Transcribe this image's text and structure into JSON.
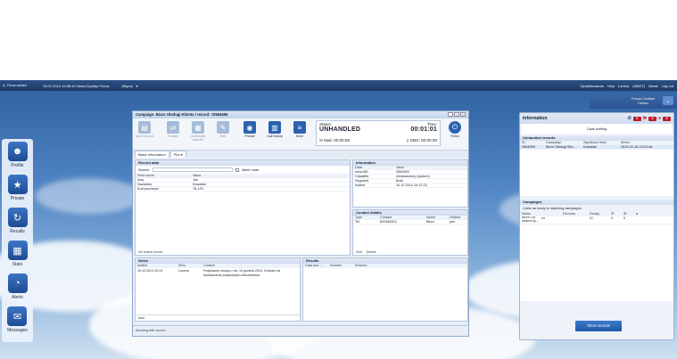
{
  "topbar": {
    "logo": "Focus contact",
    "datetime": "15.01.2014 15:08:10 News-Synteja Focus",
    "menu": "Więcej",
    "right_items": [
      "Opublikowania",
      "Help",
      "Lorena",
      "(30007)",
      "Break",
      "Log out"
    ]
  },
  "top_right": {
    "title": "Focus Contact Center"
  },
  "nav": [
    {
      "label": "Profile",
      "icon": "person-icon"
    },
    {
      "label": "Private",
      "icon": "star-icon"
    },
    {
      "label": "Recalls",
      "icon": "recall-icon"
    },
    {
      "label": "Stats",
      "icon": "chart-icon"
    },
    {
      "label": "Alerts",
      "icon": "pie-icon"
    },
    {
      "label": "Messages",
      "icon": "message-icon"
    }
  ],
  "window": {
    "title": "Campaign: Biuro Obsługi Klienta / record: #2584599",
    "toolbar": [
      {
        "label": "Move record",
        "enabled": false
      },
      {
        "label": "Transfer",
        "enabled": false
      },
      {
        "label": "Scheduled transfer",
        "enabled": false
      },
      {
        "label": "Hint",
        "enabled": false
      },
      {
        "label": "Private",
        "enabled": true
      },
      {
        "label": "Call history",
        "enabled": true
      },
      {
        "label": "More",
        "enabled": true
      }
    ],
    "status_label": "Status:",
    "status_value": "UNHANDLED",
    "time_label": "Time:",
    "time_value": "00:01:01",
    "mail_label": "Mail: 00:00:00",
    "sms_label": "SMS: 00:00:00",
    "finish_label": "Finish",
    "tabs": [
      "Basic information",
      "Plot"
    ],
    "record_data": {
      "title": "Record data",
      "search_label": "Search:",
      "match_case": "Match case",
      "headers": [
        "Field name",
        "Value"
      ],
      "rows": [
        [
          "Imię",
          "Jan"
        ],
        [
          "Nazwisko",
          "Kowalski"
        ],
        [
          "Kod pocztowe",
          "78-120"
        ]
      ],
      "footer": "No match found"
    },
    "information": {
      "title": "Information",
      "headers": [
        "Data",
        "Value"
      ],
      "rows": [
        [
          "recordID",
          "2584599"
        ],
        [
          "Classifier",
          "nieobsłużony (system)"
        ],
        [
          "Segment",
          "Brak"
        ],
        [
          "Added",
          "10.12.2014 10:12:22"
        ]
      ]
    },
    "contact_details": {
      "title": "Contact details",
      "headers": [
        "Type",
        "Contact",
        "Name",
        "Default"
      ],
      "rows": [
        [
          "Tel.",
          "820484912",
          "Biuro",
          "yes"
        ]
      ],
      "actions": [
        "Add",
        "Delete"
      ]
    },
    "notes": {
      "title": "Notes",
      "headers": [
        "Added",
        "Who",
        "Content"
      ],
      "rows": [
        [
          "10.12.2014 10:13",
          "Lucena",
          "Podpisanie umowy z dn. 10 grudnia 2014. Czekam na dostarczenie podpisanych dokumentów."
        ]
      ],
      "action": "Add"
    },
    "results": {
      "title": "Results",
      "headers": [
        "Data and ...",
        "Number",
        "Session"
      ]
    },
    "footer_status": "Working with record"
  },
  "right_panel": {
    "title": "Information",
    "badges": [
      "0",
      "0",
      "0"
    ],
    "call_status": "Calls waiting",
    "unhandled_title": "Unhandled records",
    "unhandled_headers": [
      "ID",
      "Campaign",
      "Significant field",
      "When"
    ],
    "unhandled_rows": [
      [
        "2584599",
        "Biuro Obsługi Klie...",
        "Kowalski",
        "2015-01-15 15:12:46"
      ]
    ],
    "campaigns_title": "Campaigns",
    "campaigns_hint": "Cahie as ready to matching campaigns",
    "campaign_headers": [
      "Name",
      "Records",
      "Ready"
    ],
    "campaign_rows": [
      [
        "Biuro Ob. shared (u...",
        "0",
        "0"
      ]
    ],
    "show_records": "Show records"
  }
}
